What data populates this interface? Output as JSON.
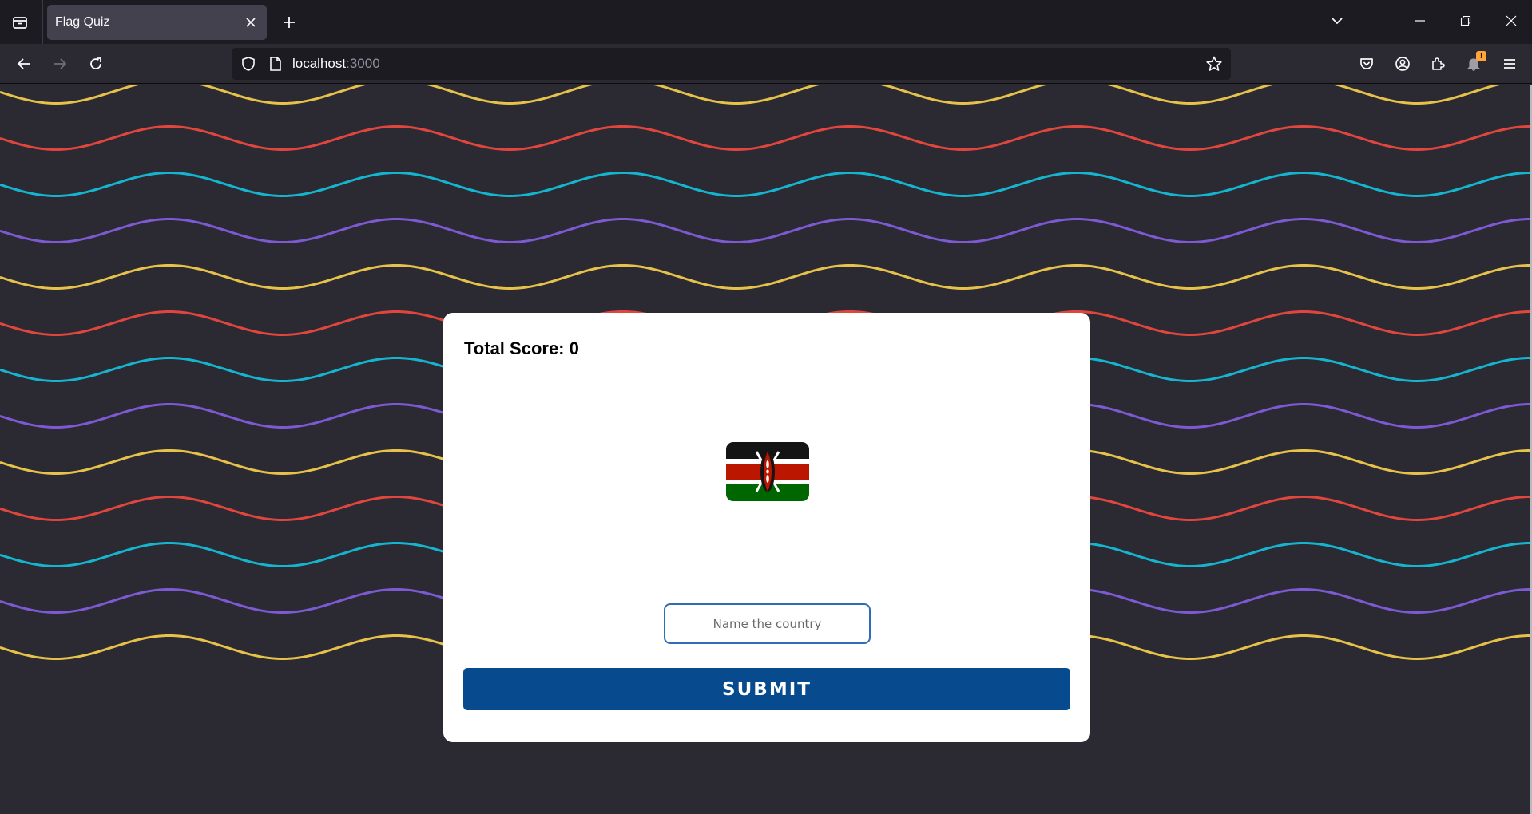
{
  "browser": {
    "tab": {
      "title": "Flag Quiz"
    },
    "url": {
      "host": "localhost",
      "port": ":3000"
    },
    "notification_badge": "!"
  },
  "quiz": {
    "score_label": "Total Score: 0",
    "flag": {
      "country_code": "KE",
      "icon": "kenya-flag"
    },
    "input": {
      "placeholder": "Name the country",
      "value": ""
    },
    "submit_label": "SUBMIT"
  },
  "colors": {
    "wave_yellow": "#e6c24a",
    "wave_red": "#e0463d",
    "wave_cyan": "#16b5cf",
    "wave_purple": "#7d59d3",
    "submit_bg": "#074b8e",
    "input_border": "#2f6db5"
  }
}
